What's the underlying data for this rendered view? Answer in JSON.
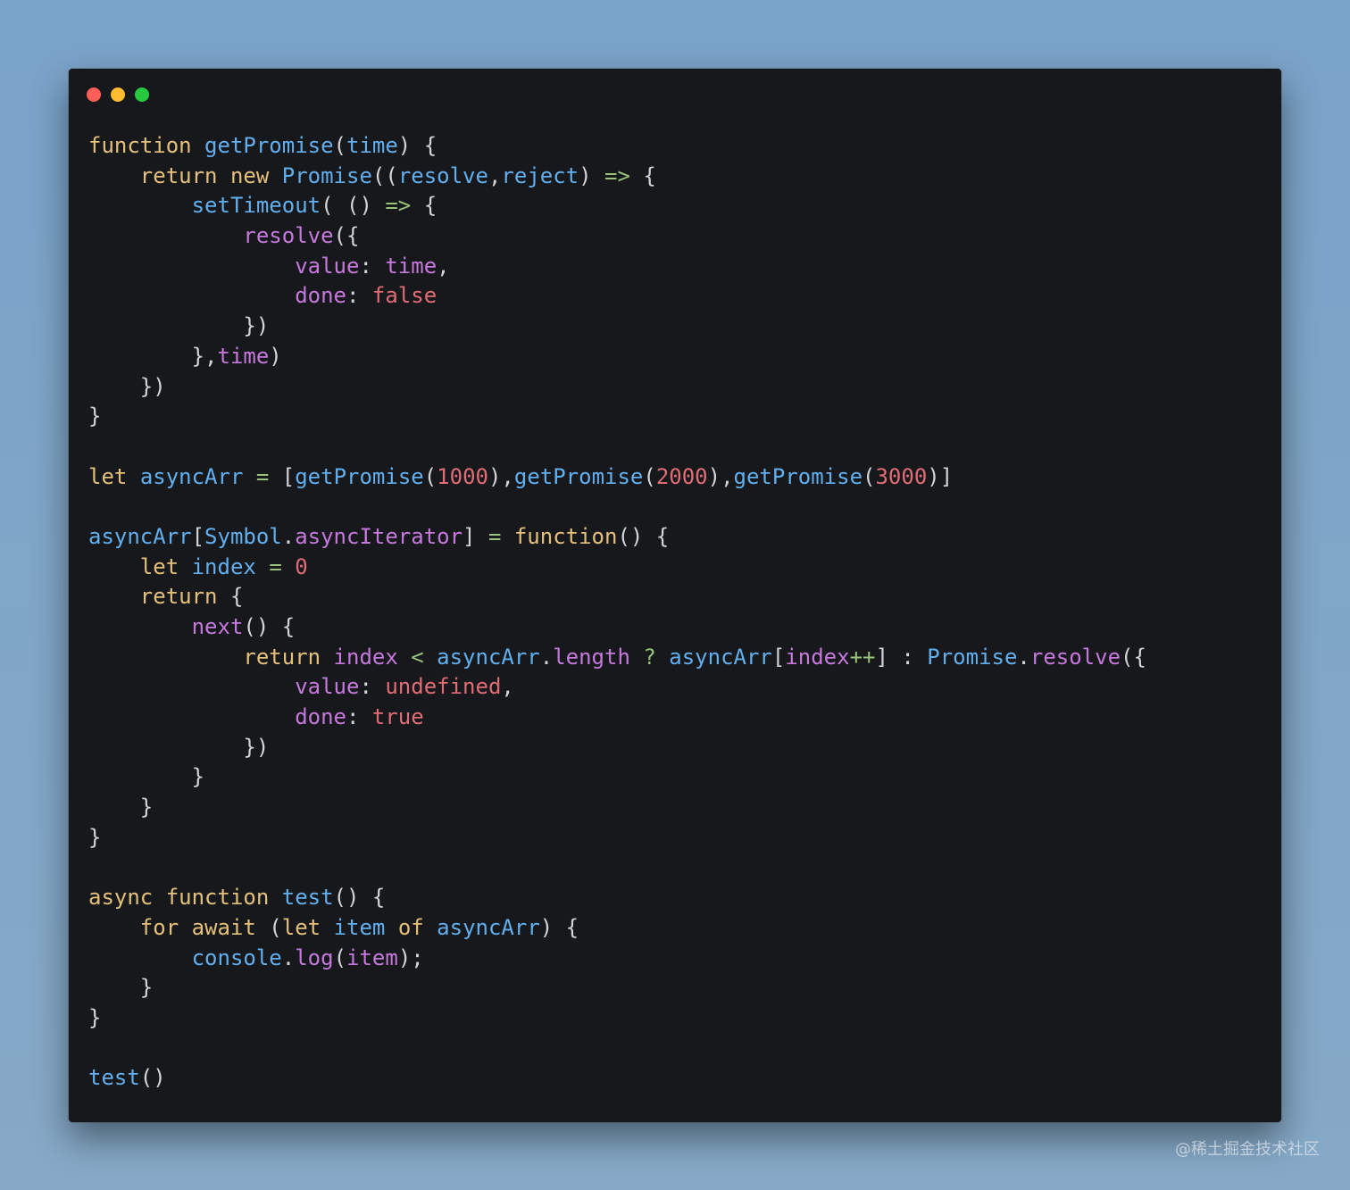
{
  "window": {
    "traffic_lights": [
      {
        "name": "close",
        "color": "#ff5f57"
      },
      {
        "name": "minimize",
        "color": "#febc2e"
      },
      {
        "name": "maximize",
        "color": "#28c840"
      }
    ]
  },
  "colors": {
    "kw": "#e5c07b",
    "fn": "#61afef",
    "prop": "#c678dd",
    "num": "#e06c75",
    "op": "#98c379",
    "plain": "#d4d4d4"
  },
  "code_lines": [
    [
      [
        "kw",
        "function"
      ],
      [
        "plain",
        " "
      ],
      [
        "fn",
        "getPromise"
      ],
      [
        "plain",
        "("
      ],
      [
        "fn",
        "time"
      ],
      [
        "plain",
        ") {"
      ]
    ],
    [
      [
        "plain",
        "    "
      ],
      [
        "kw",
        "return new "
      ],
      [
        "fn",
        "Promise"
      ],
      [
        "plain",
        "(("
      ],
      [
        "fn",
        "resolve"
      ],
      [
        "plain",
        ","
      ],
      [
        "fn",
        "reject"
      ],
      [
        "plain",
        ") "
      ],
      [
        "op",
        "=>"
      ],
      [
        "plain",
        " {"
      ]
    ],
    [
      [
        "plain",
        "        "
      ],
      [
        "fn",
        "setTimeout"
      ],
      [
        "plain",
        "( () "
      ],
      [
        "op",
        "=>"
      ],
      [
        "plain",
        " {"
      ]
    ],
    [
      [
        "plain",
        "            "
      ],
      [
        "prop",
        "resolve"
      ],
      [
        "plain",
        "({"
      ]
    ],
    [
      [
        "plain",
        "                "
      ],
      [
        "prop",
        "value"
      ],
      [
        "plain",
        ": "
      ],
      [
        "prop",
        "time"
      ],
      [
        "plain",
        ","
      ]
    ],
    [
      [
        "plain",
        "                "
      ],
      [
        "prop",
        "done"
      ],
      [
        "plain",
        ": "
      ],
      [
        "num",
        "false"
      ]
    ],
    [
      [
        "plain",
        "            })"
      ]
    ],
    [
      [
        "plain",
        "        },"
      ],
      [
        "prop",
        "time"
      ],
      [
        "plain",
        ")"
      ]
    ],
    [
      [
        "plain",
        "    })"
      ]
    ],
    [
      [
        "plain",
        "}"
      ]
    ],
    [
      [
        "plain",
        ""
      ]
    ],
    [
      [
        "kw",
        "let"
      ],
      [
        "plain",
        " "
      ],
      [
        "fn",
        "asyncArr"
      ],
      [
        "plain",
        " "
      ],
      [
        "op",
        "="
      ],
      [
        "plain",
        " ["
      ],
      [
        "fn",
        "getPromise"
      ],
      [
        "plain",
        "("
      ],
      [
        "num",
        "1000"
      ],
      [
        "plain",
        "),"
      ],
      [
        "fn",
        "getPromise"
      ],
      [
        "plain",
        "("
      ],
      [
        "num",
        "2000"
      ],
      [
        "plain",
        "),"
      ],
      [
        "fn",
        "getPromise"
      ],
      [
        "plain",
        "("
      ],
      [
        "num",
        "3000"
      ],
      [
        "plain",
        ")]"
      ]
    ],
    [
      [
        "plain",
        ""
      ]
    ],
    [
      [
        "fn",
        "asyncArr"
      ],
      [
        "plain",
        "["
      ],
      [
        "fn",
        "Symbol"
      ],
      [
        "plain",
        "."
      ],
      [
        "prop",
        "asyncIterator"
      ],
      [
        "plain",
        "] "
      ],
      [
        "op",
        "="
      ],
      [
        "plain",
        " "
      ],
      [
        "kw",
        "function"
      ],
      [
        "plain",
        "() {"
      ]
    ],
    [
      [
        "plain",
        "    "
      ],
      [
        "kw",
        "let"
      ],
      [
        "plain",
        " "
      ],
      [
        "fn",
        "index"
      ],
      [
        "plain",
        " "
      ],
      [
        "op",
        "="
      ],
      [
        "plain",
        " "
      ],
      [
        "num",
        "0"
      ]
    ],
    [
      [
        "plain",
        "    "
      ],
      [
        "kw",
        "return"
      ],
      [
        "plain",
        " {"
      ]
    ],
    [
      [
        "plain",
        "        "
      ],
      [
        "prop",
        "next"
      ],
      [
        "plain",
        "() {"
      ]
    ],
    [
      [
        "plain",
        "            "
      ],
      [
        "kw",
        "return"
      ],
      [
        "plain",
        " "
      ],
      [
        "prop",
        "index"
      ],
      [
        "plain",
        " "
      ],
      [
        "op",
        "<"
      ],
      [
        "plain",
        " "
      ],
      [
        "fn",
        "asyncArr"
      ],
      [
        "plain",
        "."
      ],
      [
        "prop",
        "length"
      ],
      [
        "plain",
        " "
      ],
      [
        "op",
        "?"
      ],
      [
        "plain",
        " "
      ],
      [
        "fn",
        "asyncArr"
      ],
      [
        "plain",
        "["
      ],
      [
        "prop",
        "index"
      ],
      [
        "op",
        "++"
      ],
      [
        "plain",
        "] : "
      ],
      [
        "fn",
        "Promise"
      ],
      [
        "plain",
        "."
      ],
      [
        "prop",
        "resolve"
      ],
      [
        "plain",
        "({"
      ]
    ],
    [
      [
        "plain",
        "                "
      ],
      [
        "prop",
        "value"
      ],
      [
        "plain",
        ": "
      ],
      [
        "num",
        "undefined"
      ],
      [
        "plain",
        ","
      ]
    ],
    [
      [
        "plain",
        "                "
      ],
      [
        "prop",
        "done"
      ],
      [
        "plain",
        ": "
      ],
      [
        "num",
        "true"
      ]
    ],
    [
      [
        "plain",
        "            })"
      ]
    ],
    [
      [
        "plain",
        "        }"
      ]
    ],
    [
      [
        "plain",
        "    }"
      ]
    ],
    [
      [
        "plain",
        "}"
      ]
    ],
    [
      [
        "plain",
        ""
      ]
    ],
    [
      [
        "kw",
        "async function"
      ],
      [
        "plain",
        " "
      ],
      [
        "fn",
        "test"
      ],
      [
        "plain",
        "() {"
      ]
    ],
    [
      [
        "plain",
        "    "
      ],
      [
        "kw",
        "for await"
      ],
      [
        "plain",
        " ("
      ],
      [
        "kw",
        "let"
      ],
      [
        "plain",
        " "
      ],
      [
        "fn",
        "item"
      ],
      [
        "plain",
        " "
      ],
      [
        "kw",
        "of"
      ],
      [
        "plain",
        " "
      ],
      [
        "fn",
        "asyncArr"
      ],
      [
        "plain",
        ") {"
      ]
    ],
    [
      [
        "plain",
        "        "
      ],
      [
        "fn",
        "console"
      ],
      [
        "plain",
        "."
      ],
      [
        "prop",
        "log"
      ],
      [
        "plain",
        "("
      ],
      [
        "prop",
        "item"
      ],
      [
        "plain",
        ");"
      ]
    ],
    [
      [
        "plain",
        "    }"
      ]
    ],
    [
      [
        "plain",
        "}"
      ]
    ],
    [
      [
        "plain",
        ""
      ]
    ],
    [
      [
        "fn",
        "test"
      ],
      [
        "plain",
        "()"
      ]
    ]
  ],
  "watermark": "@稀土掘金技术社区"
}
